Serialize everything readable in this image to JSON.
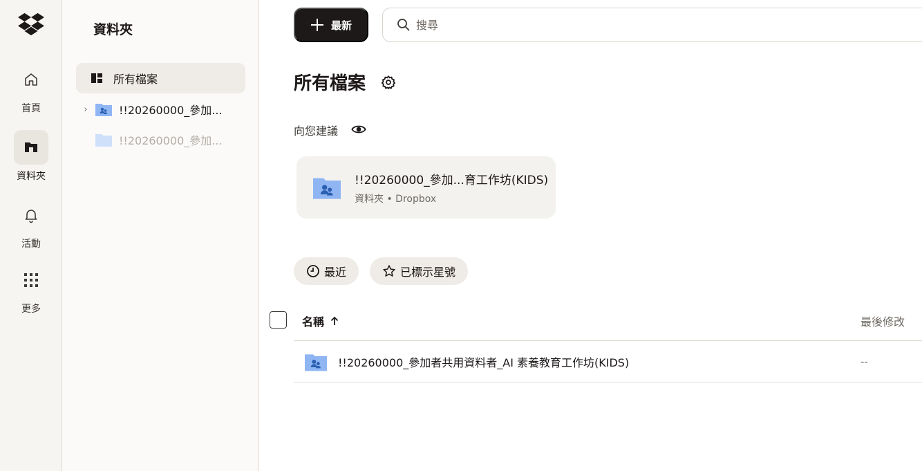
{
  "rail": {
    "items": [
      {
        "label": "首頁",
        "icon": "home-icon"
      },
      {
        "label": "資料夾",
        "icon": "folder-icon",
        "active": true
      },
      {
        "label": "活動",
        "icon": "bell-icon"
      },
      {
        "label": "更多",
        "icon": "apps-grid-icon"
      }
    ]
  },
  "panel": {
    "title": "資料夾",
    "tree": [
      {
        "label": "所有檔案",
        "icon": "all-files-icon",
        "selected": true
      },
      {
        "label": "!!20260000_參加...",
        "icon": "shared-folder-icon",
        "expandable": true
      },
      {
        "label": "!!20260000_參加...",
        "icon": "folder-icon",
        "dimmed": true
      }
    ]
  },
  "toolbar": {
    "new_label": "最新",
    "search_placeholder": "搜尋"
  },
  "main": {
    "title": "所有檔案",
    "suggest_title": "向您建議",
    "suggestion": {
      "name": "!!20260000_參加...育工作坊(KIDS)",
      "meta": "資料夾 • Dropbox"
    },
    "chips": [
      {
        "label": "最近",
        "icon": "clock-icon"
      },
      {
        "label": "已標示星號",
        "icon": "star-icon"
      }
    ],
    "table": {
      "col_name": "名稱",
      "col_modified": "最後修改",
      "rows": [
        {
          "name": "!!20260000_參加者共用資料者_AI 素養教育工作坊(KIDS)",
          "modified": "--"
        }
      ]
    }
  },
  "colors": {
    "accent_dark": "#1e1919",
    "folder_blue": "#8fb6f3",
    "rail_bg": "#f7f5f2"
  }
}
